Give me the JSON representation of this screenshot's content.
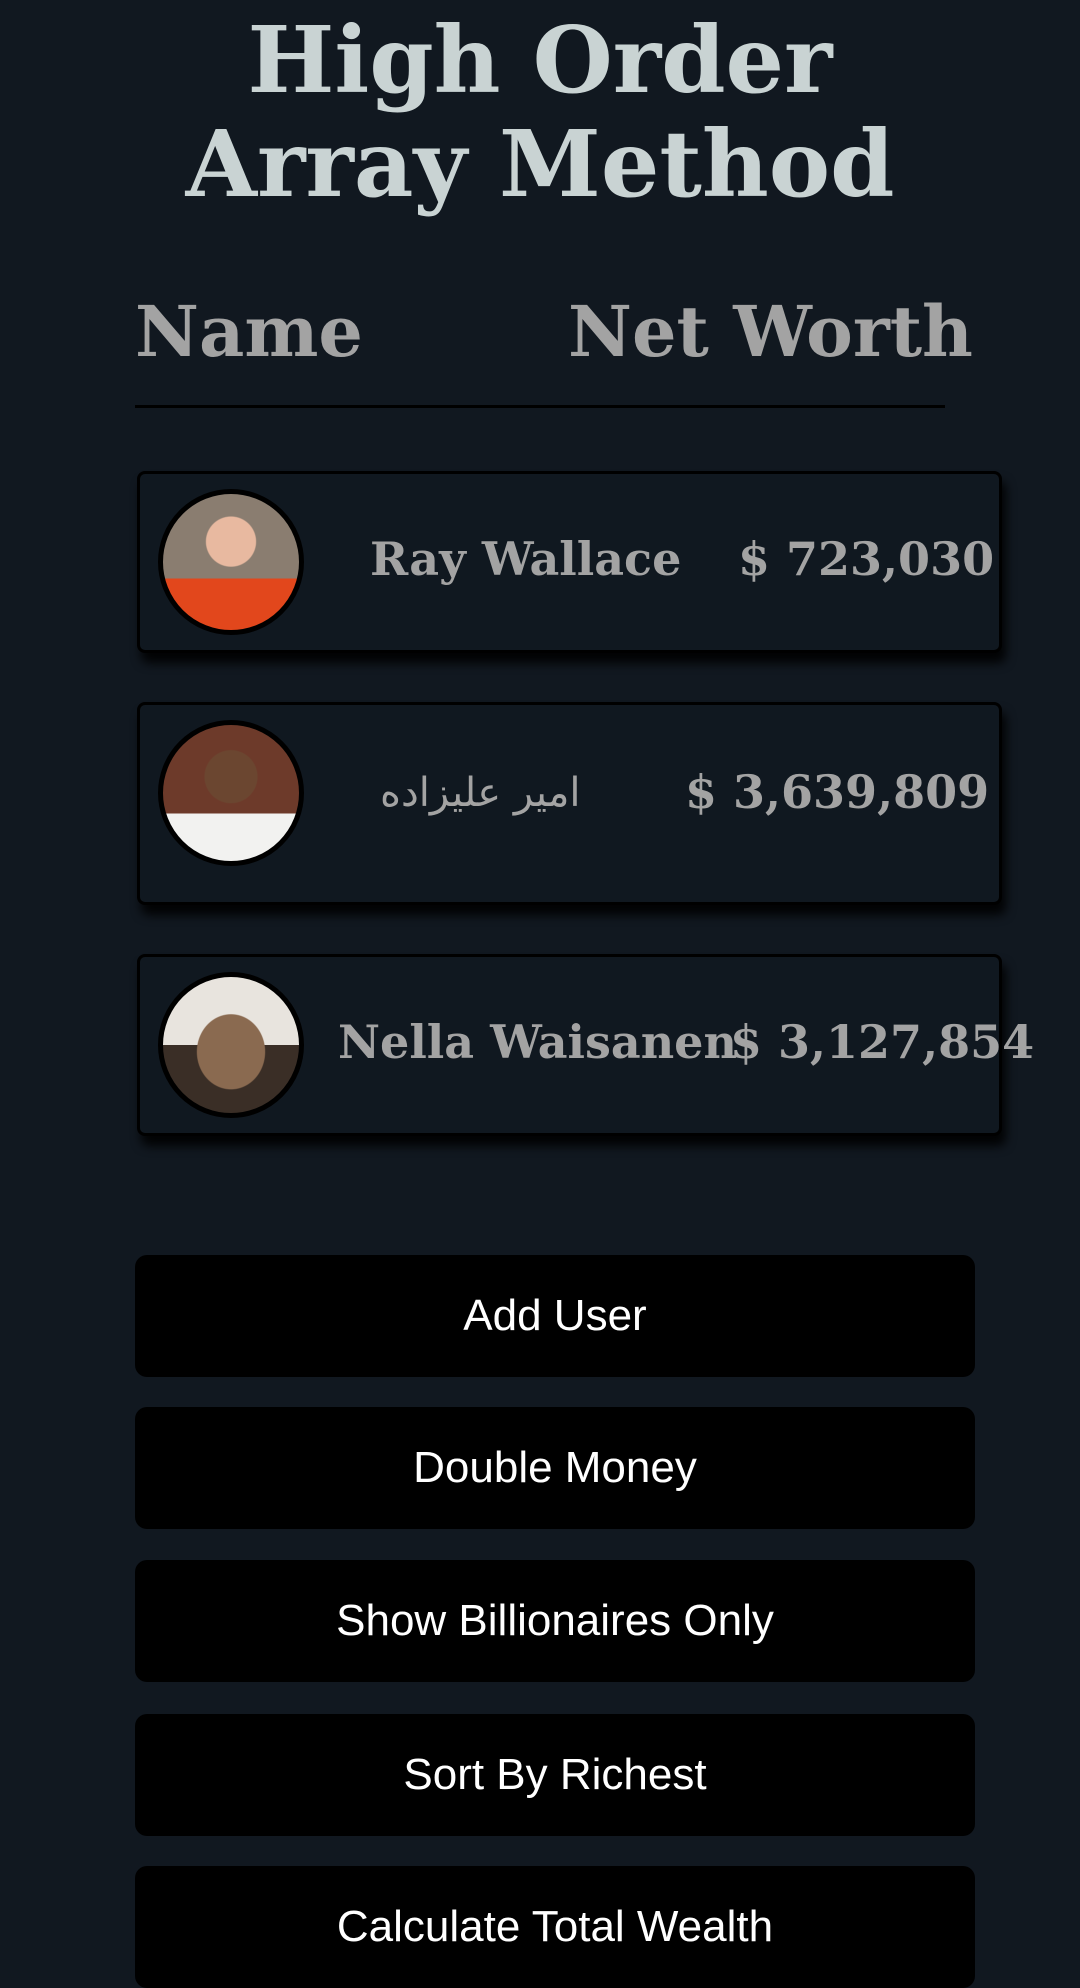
{
  "title": "High Order Array Method",
  "headers": {
    "name": "Name",
    "net_worth": "Net Worth"
  },
  "users": [
    {
      "name": "Ray Wallace",
      "worth": "$ 723,030"
    },
    {
      "name": "امیر علیزاده",
      "worth": "$ 3,639,809"
    },
    {
      "name": "Nella Waisanen",
      "worth": "$ 3,127,854"
    }
  ],
  "buttons": [
    "Add User",
    "Double Money",
    "Show Billionaires Only",
    "Sort By Richest",
    "Calculate Total Wealth"
  ]
}
